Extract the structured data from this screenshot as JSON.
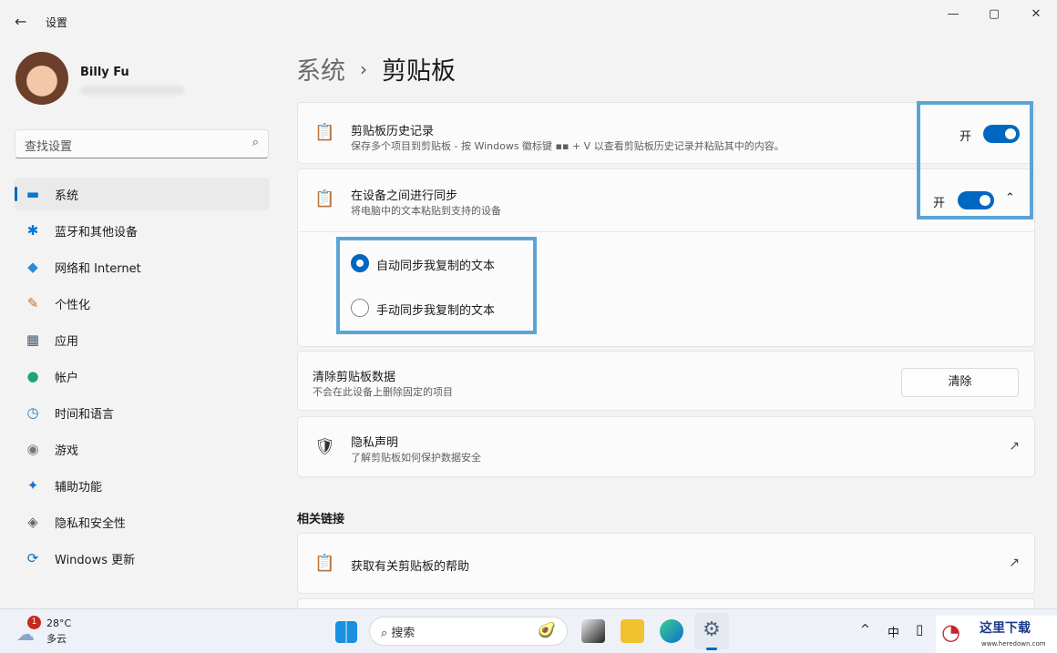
{
  "window": {
    "title": "设置",
    "minimize": "—",
    "maximize": "▢",
    "close": "✕",
    "back": "←"
  },
  "user": {
    "name": "Billy Fu"
  },
  "search": {
    "placeholder": "查找设置",
    "icon": "⌕"
  },
  "nav": [
    {
      "label": "系统",
      "icon": "▬",
      "color": "#0078d4"
    },
    {
      "label": "蓝牙和其他设备",
      "icon": "✱",
      "color": "#0078d4"
    },
    {
      "label": "网络和 Internet",
      "icon": "◆",
      "color": "#2a8ad4"
    },
    {
      "label": "个性化",
      "icon": "✎",
      "color": "#c07030"
    },
    {
      "label": "应用",
      "icon": "▦",
      "color": "#4a5a70"
    },
    {
      "label": "帐户",
      "icon": "●",
      "color": "#1fa37a"
    },
    {
      "label": "时间和语言",
      "icon": "◷",
      "color": "#1b7fc4"
    },
    {
      "label": "游戏",
      "icon": "◉",
      "color": "#777"
    },
    {
      "label": "辅助功能",
      "icon": "✦",
      "color": "#1a73c8"
    },
    {
      "label": "隐私和安全性",
      "icon": "◈",
      "color": "#666"
    },
    {
      "label": "Windows 更新",
      "icon": "⟳",
      "color": "#0a6fc2"
    }
  ],
  "breadcrumb": {
    "parent": "系统",
    "sep": "›",
    "current": "剪贴板"
  },
  "history": {
    "title": "剪贴板历史记录",
    "desc": "保存多个项目到剪贴板 - 按 Windows 徽标键 ▪▪ + V 以查看剪贴板历史记录并粘贴其中的内容。",
    "state": "开",
    "on": true
  },
  "sync": {
    "title": "在设备之间进行同步",
    "desc": "将电脑中的文本粘贴到支持的设备",
    "state": "开",
    "on": true,
    "chevron": "⌃",
    "options": [
      {
        "label": "自动同步我复制的文本",
        "selected": true
      },
      {
        "label": "手动同步我复制的文本",
        "selected": false
      }
    ]
  },
  "clear": {
    "title": "清除剪贴板数据",
    "desc": "不会在此设备上删除固定的项目",
    "button": "清除"
  },
  "privacy": {
    "title": "隐私声明",
    "desc": "了解剪贴板如何保护数据安全",
    "ext": "↗"
  },
  "related": {
    "heading": "相关链接",
    "help": "获取有关剪贴板的帮助",
    "ext": "↗"
  },
  "taskbar": {
    "weather_temp": "28°C",
    "weather_desc": "多云",
    "badge": "1",
    "search": "搜索",
    "tray_up": "^",
    "ime": "中"
  },
  "watermark": {
    "text": "这里下载",
    "url": "www.heredown.com"
  },
  "colors": {
    "accent": "#0067c0",
    "highlight": "#5aa4d6"
  }
}
